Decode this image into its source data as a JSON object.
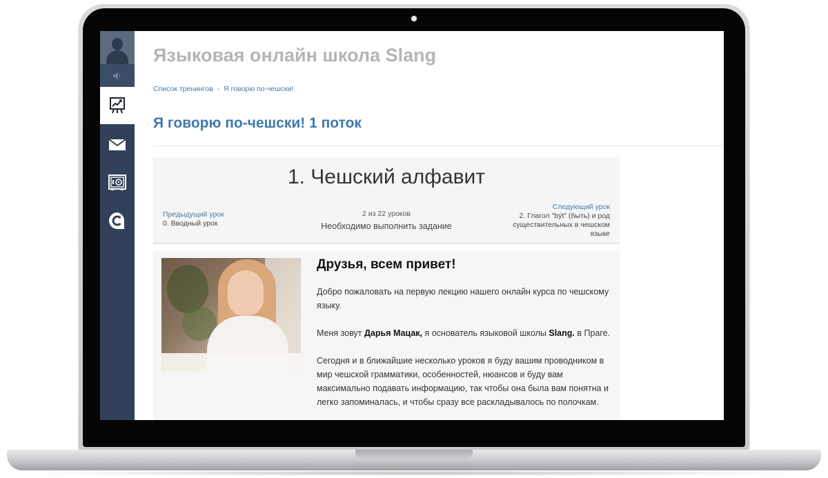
{
  "page": {
    "school_title": "Языковая онлайн школа Slang",
    "breadcrumb": {
      "root": "Список тренингов",
      "separator": "-",
      "current": "Я говорю по-чешски!"
    },
    "course_title": "Я говорю по-чешски! 1 поток"
  },
  "sidebar": {
    "items": [
      {
        "icon": "presentation-chart-icon",
        "active": true
      },
      {
        "icon": "envelope-icon",
        "active": false
      },
      {
        "icon": "safe-icon",
        "active": false
      },
      {
        "icon": "c-logo-icon",
        "active": false
      }
    ],
    "sound_icon": "speaker-icon",
    "avatar_icon": "user-silhouette-icon"
  },
  "lesson": {
    "title": "1. Чешский алфавит",
    "prev_label": "Предыдущий урок",
    "prev_name": "0. Вводный урок",
    "progress": "2 из 22 уроков",
    "progress_current": 2,
    "progress_total": 22,
    "task": "Необходимо выполнить задание",
    "next_label": "Следующий урок",
    "next_name": "2. Глагол \"být\" (быть) и род существительных в чешском языке"
  },
  "content": {
    "greeting": "Друзья, всем привет!",
    "p1": "Добро пожаловать на первую лекцию нашего онлайн курса по чешскому языку.",
    "p2_before": "Меня зовут ",
    "p2_name": "Дарья Мацак,",
    "p2_middle": " я основатель языковой школы ",
    "p2_school": "Slang.",
    "p2_after": " в Праге.",
    "p3": "Сегодня и в ближайшие несколько уроков я буду вашим проводником в мир чешской грамматики, особенностей, нюансов и буду вам максимально подавать информацию, так чтобы она была вам понятна и легко запоминалась, и чтобы сразу все раскладывалось по полочкам."
  },
  "colors": {
    "sidebar_bg": "#304159",
    "link_blue": "#4a79a6",
    "course_title_blue": "#3f78ac",
    "school_title_gray": "#b3b5b8"
  }
}
